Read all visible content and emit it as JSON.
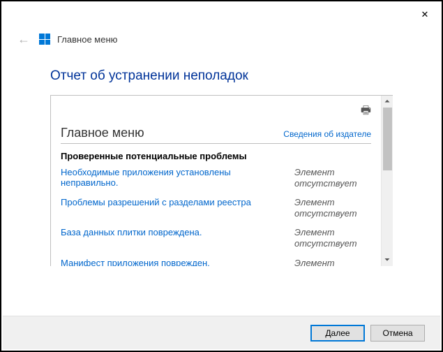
{
  "titlebar": {
    "close_glyph": "✕"
  },
  "header": {
    "back_glyph": "←",
    "title": "Главное меню"
  },
  "main": {
    "title": "Отчет об устранении неполадок"
  },
  "report": {
    "print_glyph": "🖶",
    "heading": "Главное меню",
    "publisher_link": "Сведения об издателе",
    "section_title": "Проверенные потенциальные проблемы",
    "problems": [
      {
        "label": "Необходимые приложения установлены неправильно.",
        "status": "Элемент отсутствует"
      },
      {
        "label": "Проблемы разрешений с разделами реестра",
        "status": "Элемент отсутствует"
      },
      {
        "label": "База данных плитки повреждена.",
        "status": "Элемент отсутствует"
      },
      {
        "label": "Манифест приложения поврежден.",
        "status": "Элемент отсутствует"
      }
    ]
  },
  "scrollbar": {
    "up_glyph": "⏶",
    "down_glyph": "⏷"
  },
  "footer": {
    "next_label": "Далее",
    "cancel_label": "Отмена"
  }
}
